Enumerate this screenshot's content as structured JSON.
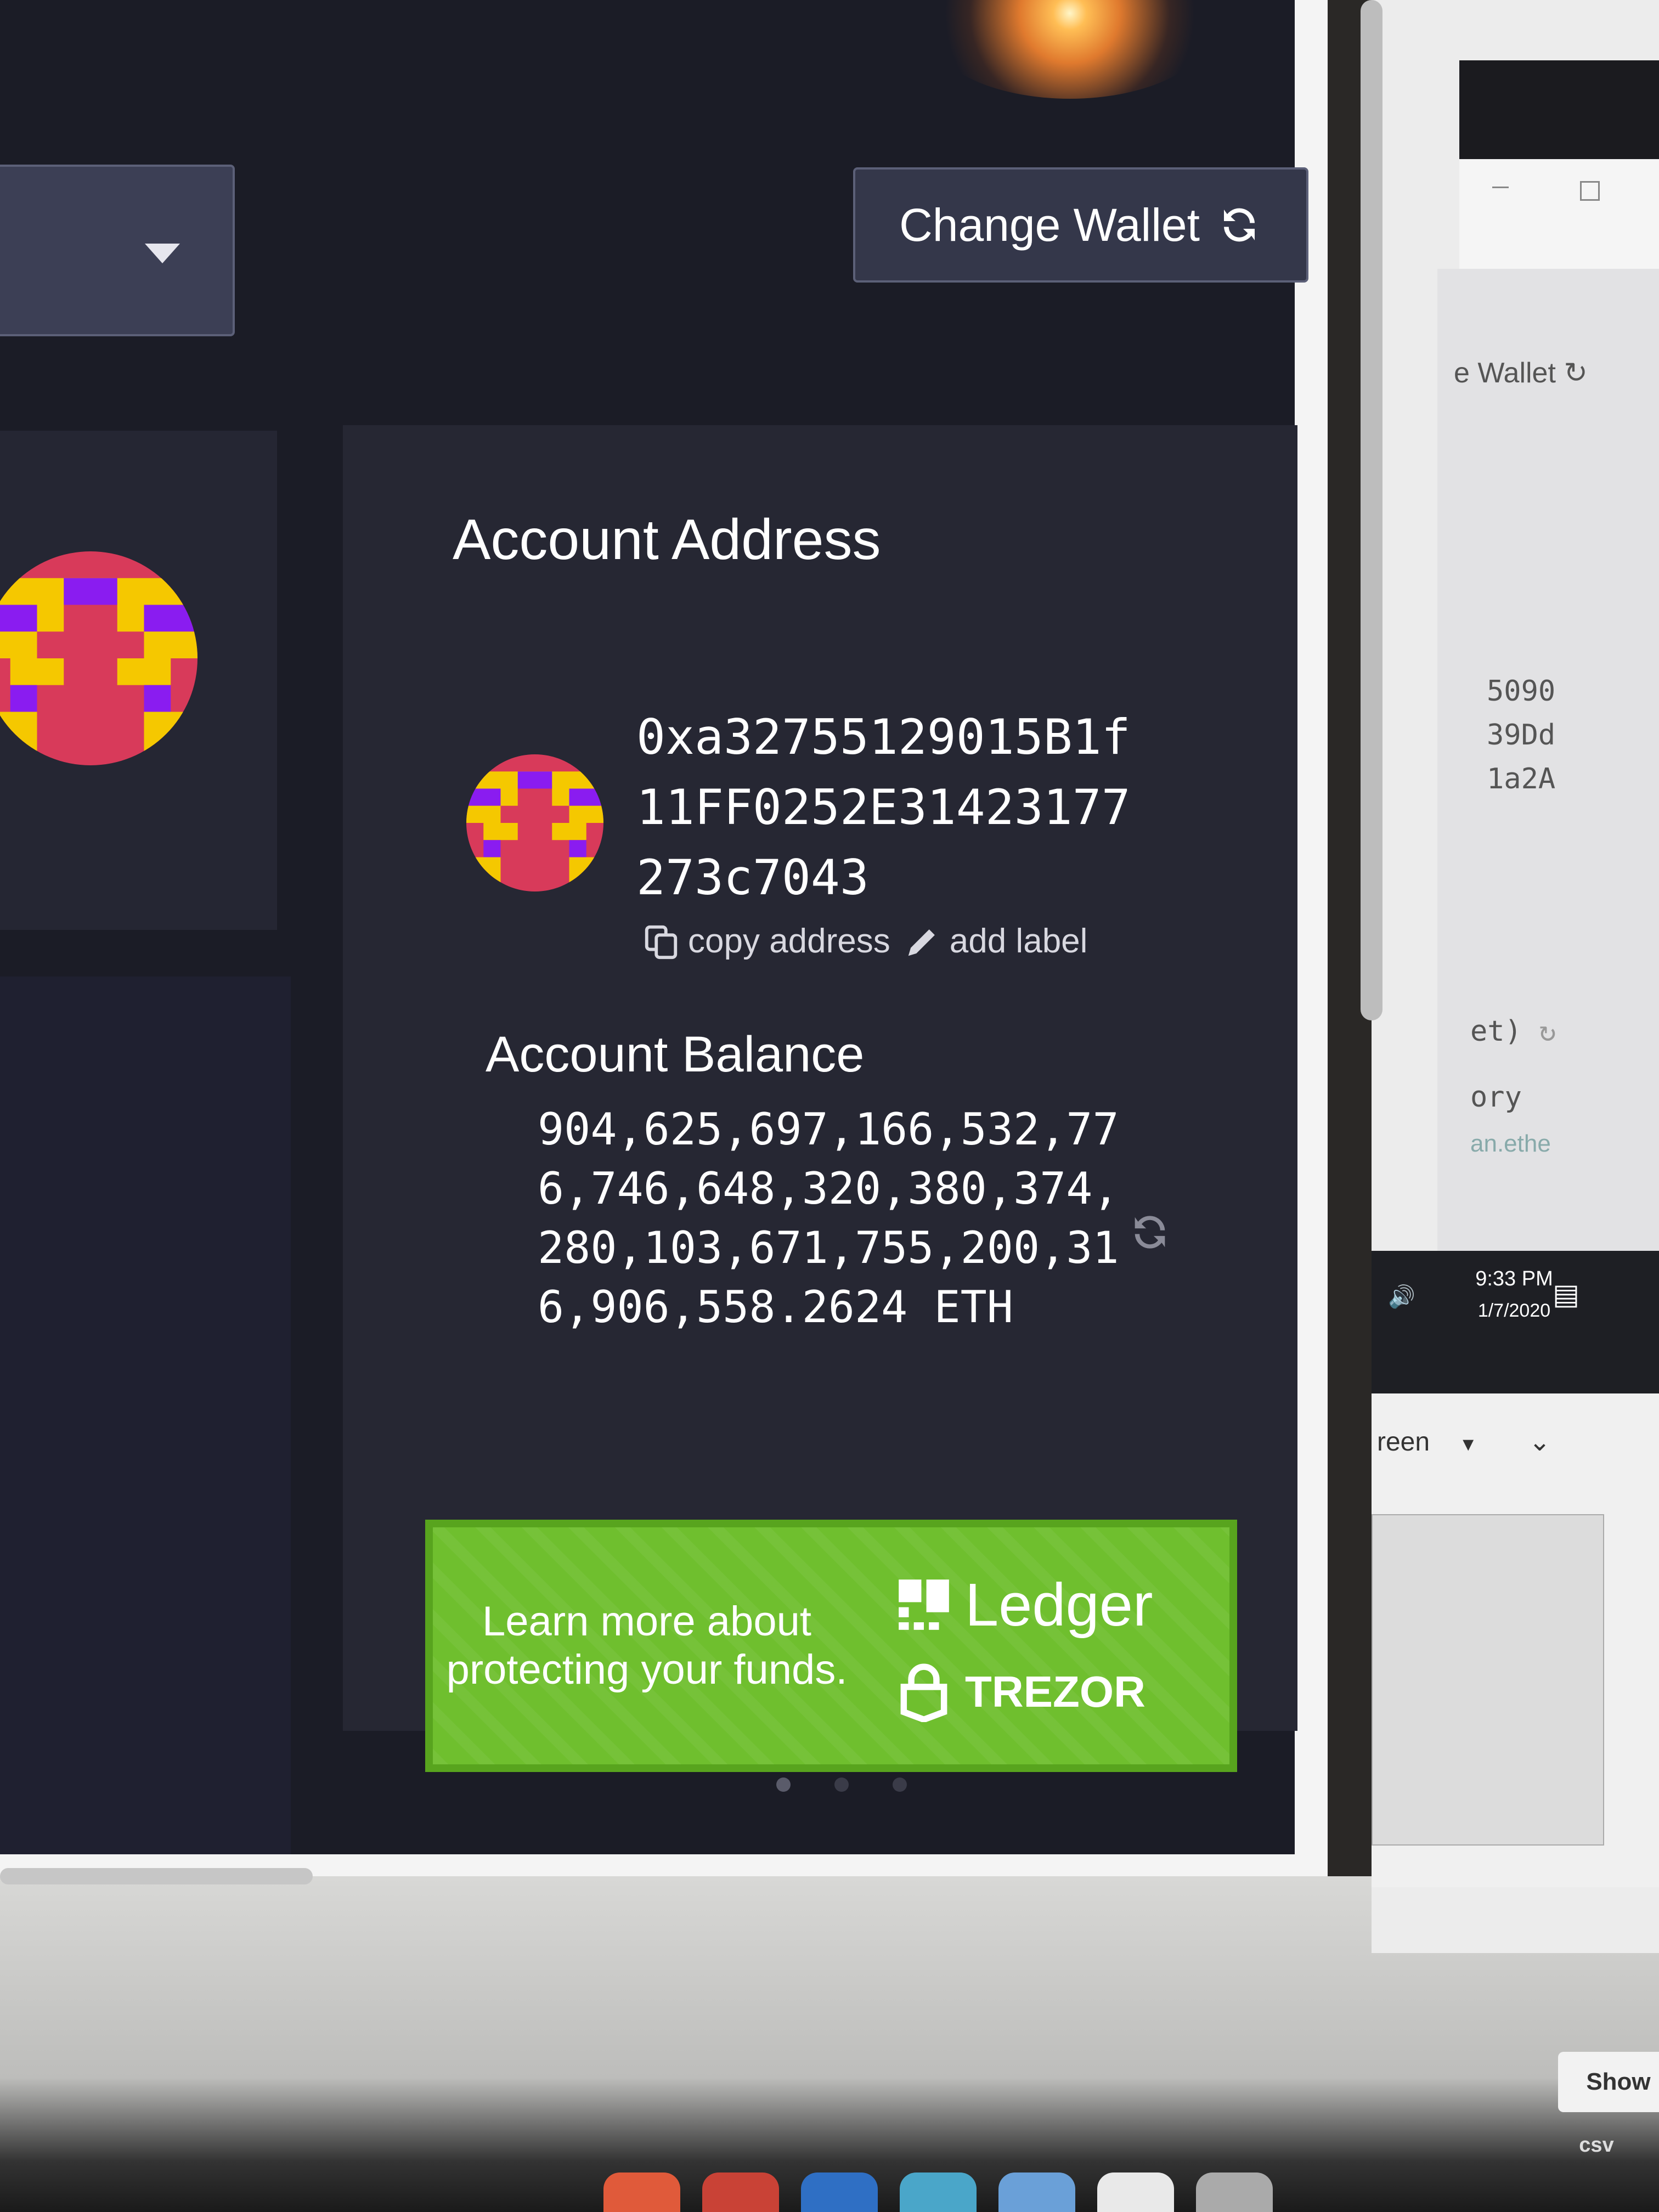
{
  "header": {
    "change_wallet_label": "Change Wallet"
  },
  "account": {
    "address_title": "Account Address",
    "address": "0xa32755129015B1f11FF0252E31423177273c7043",
    "copy_address_label": "copy address",
    "add_label_label": "add label",
    "balance_title": "Account Balance",
    "balance": "904,625,697,166,532,776,746,648,320,380,374,280,103,671,755,200,316,906,558.2624 ETH"
  },
  "banner": {
    "text": "Learn more about protecting your funds.",
    "brand_1": "Ledger",
    "brand_2": "TREZOR"
  },
  "background_window": {
    "change_wallet_partial": "e Wallet",
    "address_fragments": [
      "5090",
      "39Dd",
      "1a2A"
    ],
    "fragment_1": "et)",
    "fragment_2": "ory",
    "fragment_3": "an.ethe",
    "taskbar_time": "9:33 PM",
    "taskbar_date": "1/7/2020",
    "screen_select_partial": "reen"
  },
  "desktop": {
    "show_label": "Show",
    "csv_label": "csv"
  },
  "colors": {
    "app_background": "#1b1c26",
    "card_background": "#262733",
    "button_background": "#34374a",
    "banner_green": "#6fbf2e",
    "identicon_red": "#d83a5a",
    "identicon_yellow": "#f5c800",
    "identicon_purple": "#8a1cf0"
  },
  "icons": {
    "refresh": "refresh-icon",
    "copy": "copy-icon",
    "pencil": "pencil-icon",
    "dropdown": "caret-down-icon",
    "ledger": "ledger-logo-icon",
    "trezor": "trezor-lock-icon"
  }
}
